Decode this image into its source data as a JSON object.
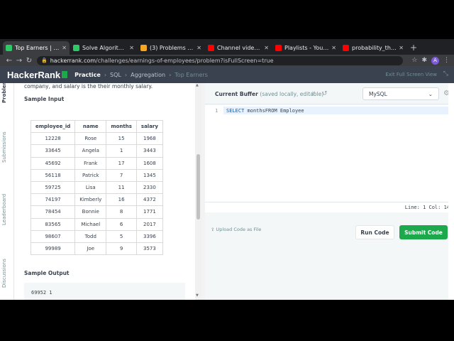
{
  "browser": {
    "tabs": [
      {
        "title": "Top Earners | Hack",
        "favicon_color": "#2ec866",
        "active": true
      },
      {
        "title": "Solve Algorithms |",
        "favicon_color": "#2ec866",
        "active": false
      },
      {
        "title": "(3) Problems - Lee",
        "favicon_color": "#f5a623",
        "active": false
      },
      {
        "title": "Channel videos - Y",
        "favicon_color": "#ff0000",
        "active": false
      },
      {
        "title": "Playlists - YouTube",
        "favicon_color": "#ff0000",
        "active": false
      },
      {
        "title": "probability_that_a",
        "favicon_color": "#ff0000",
        "active": false
      }
    ],
    "new_tab": "+",
    "url_host": "hackerrank.com",
    "url_path": "/challenges/earnings-of-employees/problem?isFullScreen=true",
    "avatar_letter": "A"
  },
  "header": {
    "logo": "HackerRank",
    "crumbs": [
      "Practice",
      "SQL",
      "Aggregation",
      "Top Earners"
    ],
    "exit_fullscreen": "Exit Full Screen View"
  },
  "side_tabs": [
    "Problem",
    "Submissions",
    "Leaderboard",
    "Discussions"
  ],
  "problem": {
    "desc_tail": "company, and salary is the their monthly salary.",
    "sample_input_heading": "Sample Input",
    "table": {
      "headers": [
        "employee_id",
        "name",
        "months",
        "salary"
      ],
      "rows": [
        [
          "12228",
          "Rose",
          "15",
          "1968"
        ],
        [
          "33645",
          "Angela",
          "1",
          "3443"
        ],
        [
          "45692",
          "Frank",
          "17",
          "1608"
        ],
        [
          "56118",
          "Patrick",
          "7",
          "1345"
        ],
        [
          "59725",
          "Lisa",
          "11",
          "2330"
        ],
        [
          "74197",
          "Kimberly",
          "16",
          "4372"
        ],
        [
          "78454",
          "Bonnie",
          "8",
          "1771"
        ],
        [
          "83565",
          "Michael",
          "6",
          "2017"
        ],
        [
          "98607",
          "Todd",
          "5",
          "3396"
        ],
        [
          "99989",
          "Joe",
          "9",
          "3573"
        ]
      ]
    },
    "sample_output_heading": "Sample Output",
    "sample_output": "69952 1"
  },
  "editor": {
    "title": "Current Buffer",
    "subtitle": "(saved locally, editable)",
    "language": "MySQL",
    "line_number": "1",
    "code_keyword": "SELECT",
    "code_rest": " monthsFROM Employee",
    "status": "Line: 1 Col: 14",
    "upload": "Upload Code as File",
    "run_label": "Run Code",
    "submit_label": "Submit Code"
  }
}
